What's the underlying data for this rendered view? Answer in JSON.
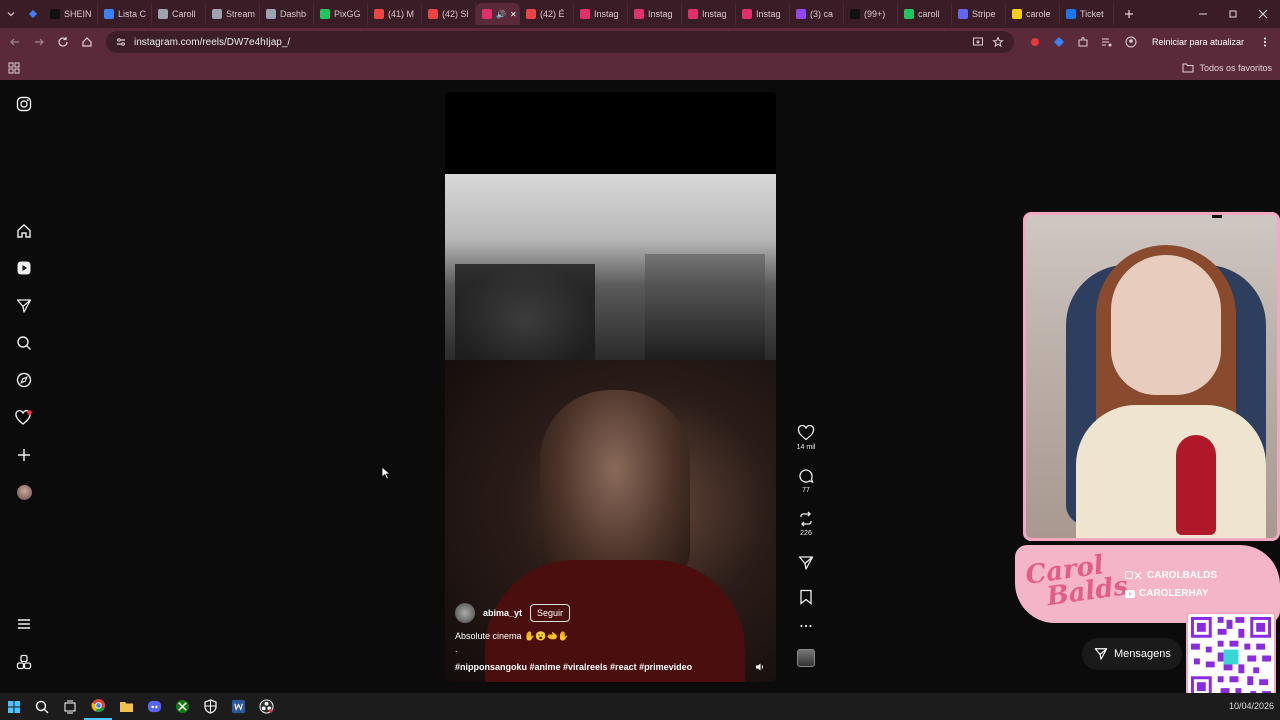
{
  "browser": {
    "tabs": [
      {
        "label": "SHEIN",
        "color": "#111111",
        "glyph": "S"
      },
      {
        "label": "Lista C",
        "color": "#3b82f6",
        "glyph": ""
      },
      {
        "label": "Caroll",
        "color": "#9ca3af",
        "glyph": ""
      },
      {
        "label": "Stream",
        "color": "#9ca3af",
        "glyph": ""
      },
      {
        "label": "Dashb",
        "color": "#9ca3af",
        "glyph": ""
      },
      {
        "label": "PixGG",
        "color": "#22c55e",
        "glyph": ""
      },
      {
        "label": "(41) M",
        "color": "#ef4444",
        "glyph": ""
      },
      {
        "label": "(42) Sl",
        "color": "#ef4444",
        "glyph": ""
      },
      {
        "label": "",
        "color": "#e1306c",
        "glyph": "",
        "active": true
      },
      {
        "label": "(42) É",
        "color": "#ef4444",
        "glyph": ""
      },
      {
        "label": "Instag",
        "color": "#e1306c",
        "glyph": ""
      },
      {
        "label": "Instag",
        "color": "#e1306c",
        "glyph": ""
      },
      {
        "label": "Instag",
        "color": "#e1306c",
        "glyph": ""
      },
      {
        "label": "Instag",
        "color": "#e1306c",
        "glyph": ""
      },
      {
        "label": "(3) ca",
        "color": "#9146ff",
        "glyph": ""
      },
      {
        "label": "(99+)",
        "color": "#111111",
        "glyph": ""
      },
      {
        "label": "caroll",
        "color": "#22c55e",
        "glyph": ""
      },
      {
        "label": "Stripe",
        "color": "#6366f1",
        "glyph": ""
      },
      {
        "label": "carole",
        "color": "#facc15",
        "glyph": ""
      },
      {
        "label": "Ticket",
        "color": "#1877f2",
        "glyph": ""
      }
    ],
    "url": "instagram.com/reels/DW7e4hIjap_/",
    "restart_label": "Reiniciar para atualizar",
    "bookmarks_label": "Todos os favoritos"
  },
  "reel": {
    "username": "abima_yt",
    "follow_label": "Seguir",
    "caption": "Absolute cinema ✋😮🫲✋",
    "caption_dot": ".",
    "hashtags": "#nipponsangoku #anime #viralreels #react #primevideo",
    "likes": "14 mil",
    "comments": "77",
    "reposts": "226"
  },
  "overlay": {
    "brand_name_1": "Carol",
    "brand_name_2": "Balds",
    "handle_1": "CAROLBALDS",
    "handle_2": "CAROLERHAY",
    "messages_label": "Mensagens"
  },
  "taskbar": {
    "date": "10/04/2026"
  },
  "colors": {
    "brand_pink": "#f5b5c8",
    "accent_pink": "#e35d8a",
    "browser_frame": "#5a2a3a"
  }
}
